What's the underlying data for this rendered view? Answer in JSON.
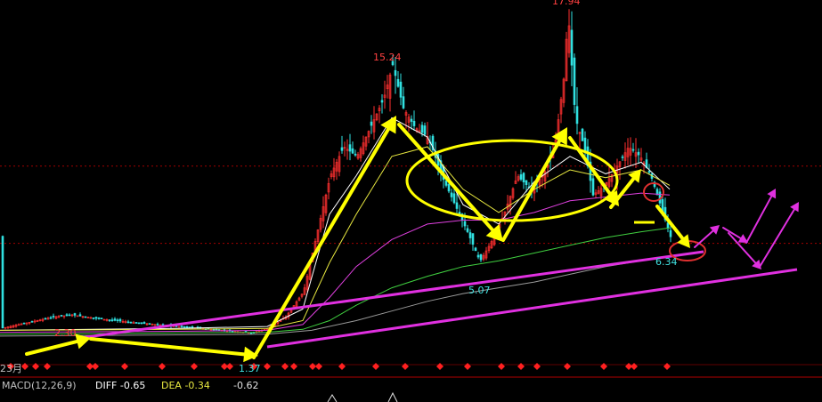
{
  "chart_data": {
    "type": "candlestick",
    "annotations": {
      "peak_1": "15.24",
      "peak_2": "17.94",
      "low_1": "5.07",
      "low_2": "6.34",
      "early_high": "2.30",
      "base_low": "1.37",
      "date_label": "23月"
    },
    "price_path": [
      [
        0,
        1.6
      ],
      [
        30,
        1.9
      ],
      [
        60,
        2.2
      ],
      [
        80,
        2.3
      ],
      [
        110,
        2.1
      ],
      [
        150,
        1.9
      ],
      [
        200,
        1.7
      ],
      [
        250,
        1.5
      ],
      [
        282,
        1.37
      ],
      [
        300,
        1.6
      ],
      [
        320,
        2.2
      ],
      [
        340,
        3.5
      ],
      [
        355,
        6.5
      ],
      [
        370,
        9.5
      ],
      [
        385,
        11.0
      ],
      [
        400,
        10.5
      ],
      [
        415,
        12.0
      ],
      [
        430,
        13.5
      ],
      [
        440,
        15.24
      ],
      [
        452,
        13.0
      ],
      [
        465,
        12.0
      ],
      [
        480,
        11.5
      ],
      [
        495,
        9.5
      ],
      [
        510,
        8.0
      ],
      [
        525,
        6.5
      ],
      [
        538,
        5.07
      ],
      [
        550,
        6.0
      ],
      [
        565,
        7.5
      ],
      [
        580,
        9.5
      ],
      [
        595,
        8.8
      ],
      [
        610,
        9.6
      ],
      [
        622,
        11.0
      ],
      [
        632,
        14.5
      ],
      [
        637,
        17.94
      ],
      [
        645,
        12.5
      ],
      [
        655,
        11.0
      ],
      [
        665,
        8.5
      ],
      [
        678,
        9.0
      ],
      [
        692,
        10.0
      ],
      [
        705,
        11.0
      ],
      [
        718,
        10.5
      ],
      [
        730,
        9.5
      ],
      [
        742,
        7.8
      ],
      [
        752,
        6.34
      ]
    ],
    "ma_lines": [
      {
        "name": "ma-white",
        "color": "#ffffff",
        "points": [
          [
            0,
            1.5
          ],
          [
            200,
            1.6
          ],
          [
            300,
            1.7
          ],
          [
            340,
            2.6
          ],
          [
            370,
            7.5
          ],
          [
            400,
            9.5
          ],
          [
            440,
            12.5
          ],
          [
            480,
            11.5
          ],
          [
            520,
            8.0
          ],
          [
            560,
            7.0
          ],
          [
            600,
            9.2
          ],
          [
            640,
            10.5
          ],
          [
            680,
            9.6
          ],
          [
            720,
            10.2
          ],
          [
            752,
            8.8
          ]
        ]
      },
      {
        "name": "ma-yellow",
        "color": "#e8e840",
        "points": [
          [
            0,
            1.5
          ],
          [
            200,
            1.55
          ],
          [
            300,
            1.6
          ],
          [
            340,
            2.0
          ],
          [
            370,
            5.0
          ],
          [
            400,
            7.5
          ],
          [
            440,
            10.5
          ],
          [
            480,
            11.0
          ],
          [
            520,
            8.8
          ],
          [
            560,
            7.6
          ],
          [
            600,
            8.8
          ],
          [
            640,
            9.8
          ],
          [
            680,
            9.4
          ],
          [
            720,
            9.8
          ],
          [
            752,
            9.0
          ]
        ]
      },
      {
        "name": "ma-magenta",
        "color": "#e040e0",
        "points": [
          [
            0,
            1.4
          ],
          [
            200,
            1.45
          ],
          [
            300,
            1.5
          ],
          [
            340,
            1.8
          ],
          [
            370,
            3.2
          ],
          [
            400,
            4.8
          ],
          [
            440,
            6.2
          ],
          [
            480,
            7.0
          ],
          [
            520,
            7.2
          ],
          [
            560,
            7.2
          ],
          [
            600,
            7.6
          ],
          [
            640,
            8.2
          ],
          [
            680,
            8.4
          ],
          [
            720,
            8.6
          ],
          [
            752,
            8.5
          ]
        ]
      },
      {
        "name": "ma-green",
        "color": "#40d040",
        "points": [
          [
            0,
            1.3
          ],
          [
            300,
            1.4
          ],
          [
            340,
            1.55
          ],
          [
            370,
            2.0
          ],
          [
            400,
            2.8
          ],
          [
            440,
            3.7
          ],
          [
            480,
            4.3
          ],
          [
            520,
            4.8
          ],
          [
            560,
            5.1
          ],
          [
            600,
            5.5
          ],
          [
            640,
            5.9
          ],
          [
            680,
            6.3
          ],
          [
            720,
            6.6
          ],
          [
            752,
            6.8
          ]
        ]
      },
      {
        "name": "ma-gray",
        "color": "#9a9a9a",
        "points": [
          [
            0,
            1.2
          ],
          [
            300,
            1.3
          ],
          [
            350,
            1.5
          ],
          [
            400,
            2.0
          ],
          [
            440,
            2.5
          ],
          [
            480,
            3.0
          ],
          [
            520,
            3.4
          ],
          [
            560,
            3.7
          ],
          [
            600,
            4.0
          ],
          [
            640,
            4.4
          ],
          [
            680,
            4.8
          ],
          [
            720,
            5.1
          ],
          [
            752,
            5.3
          ]
        ]
      }
    ],
    "ref_levels": [
      10.0,
      6.0
    ],
    "ylim": [
      0,
      18.5
    ]
  },
  "macd": {
    "label": "MACD(12,26,9)",
    "diff_label": "DIFF -0.65",
    "dea_label": "DEA -0.34",
    "macd_value": "-0.62"
  }
}
